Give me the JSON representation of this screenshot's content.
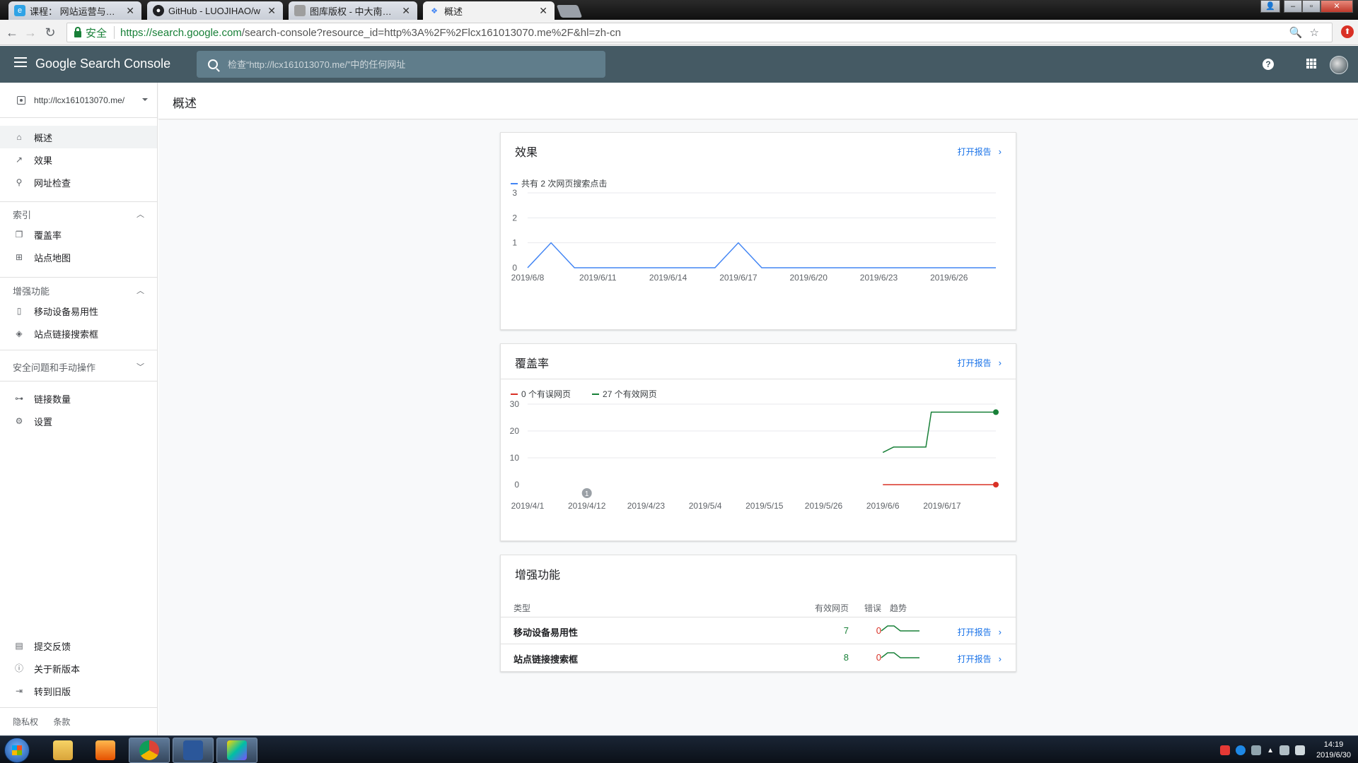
{
  "browser": {
    "tabs": [
      {
        "title": "课程： 网站运营与管理_",
        "favicon_color": "#2fa3e6"
      },
      {
        "title": "GitHub - LUOJIHAO/w",
        "favicon_color": "#202124"
      },
      {
        "title": "图库版权 - 中大南方大数",
        "favicon_color": "#9e9e9e"
      },
      {
        "title": "概述",
        "favicon_color": "#4285f4"
      }
    ],
    "secure_label": "安全",
    "url_main": "https://search.google.com",
    "url_rest": "/search-console?resource_id=http%3A%2F%2Flcx161013070.me%2F&hl=zh-cn"
  },
  "app": {
    "brand": "Google Search Console",
    "search_placeholder": "检查“http://lcx161013070.me/”中的任何网址"
  },
  "sidebar": {
    "property": "http://lcx161013070.me/",
    "top_items": [
      {
        "label": "概述",
        "icon": "home-icon"
      },
      {
        "label": "效果",
        "icon": "trending-up-icon"
      },
      {
        "label": "网址检查",
        "icon": "search-icon"
      }
    ],
    "section_index": "索引",
    "index_items": [
      {
        "label": "覆盖率",
        "icon": "copy-icon"
      },
      {
        "label": "站点地图",
        "icon": "sitemap-icon"
      }
    ],
    "section_enhance": "增强功能",
    "enhance_items": [
      {
        "label": "移动设备易用性",
        "icon": "phone-icon"
      },
      {
        "label": "站点链接搜索框",
        "icon": "layers-icon"
      }
    ],
    "section_security": "安全问题和手动操作",
    "other_items": [
      {
        "label": "链接数量",
        "icon": "links-icon"
      },
      {
        "label": "设置",
        "icon": "gear-icon"
      }
    ],
    "bottom_items": [
      {
        "label": "提交反馈",
        "icon": "feedback-icon"
      },
      {
        "label": "关于新版本",
        "icon": "info-icon"
      },
      {
        "label": "转到旧版",
        "icon": "exit-icon"
      }
    ],
    "footer_privacy": "隐私权",
    "footer_terms": "条款"
  },
  "page": {
    "title": "概述"
  },
  "performance": {
    "title": "效果",
    "open_report": "打开报告",
    "legend": "共有 2 次网页搜索点击",
    "color": "#4285f4"
  },
  "coverage": {
    "title": "覆盖率",
    "open_report": "打开报告",
    "legend_error": "0 个有误网页",
    "legend_valid": "27 个有效网页",
    "error_color": "#d93025",
    "valid_color": "#188038",
    "annotation": "1"
  },
  "enhancements": {
    "title": "增强功能",
    "headers": {
      "type": "类型",
      "valid": "有效网页",
      "errors": "错误",
      "trend": "趋势"
    },
    "rows": [
      {
        "name": "移动设备易用性",
        "valid": "7",
        "errors": "0",
        "open_report": "打开报告",
        "trend": [
          6,
          7,
          7,
          6,
          6,
          6,
          6
        ]
      },
      {
        "name": "站点链接搜索框",
        "valid": "8",
        "errors": "0",
        "open_report": "打开报告",
        "trend": [
          7,
          8,
          8,
          7,
          7,
          7,
          7
        ]
      }
    ]
  },
  "chart_data": [
    {
      "type": "line",
      "title": "效果",
      "series": [
        {
          "name": "共有 2 次网页搜索点击",
          "values": [
            0,
            1,
            0,
            0,
            0,
            0,
            0,
            0,
            0,
            1,
            0,
            0,
            0,
            0,
            0,
            0,
            0,
            0,
            0,
            0,
            0
          ]
        }
      ],
      "x": [
        "2019/6/8",
        "2019/6/9",
        "2019/6/10",
        "2019/6/11",
        "2019/6/12",
        "2019/6/13",
        "2019/6/14",
        "2019/6/15",
        "2019/6/16",
        "2019/6/17",
        "2019/6/18",
        "2019/6/19",
        "2019/6/20",
        "2019/6/21",
        "2019/6/22",
        "2019/6/23",
        "2019/6/24",
        "2019/6/25",
        "2019/6/26",
        "2019/6/27",
        "2019/6/28"
      ],
      "x_ticks": [
        "2019/6/8",
        "2019/6/11",
        "2019/6/14",
        "2019/6/17",
        "2019/6/20",
        "2019/6/23",
        "2019/6/26"
      ],
      "y_ticks": [
        0,
        1,
        2,
        3
      ],
      "ylim": [
        0,
        3
      ],
      "grid": true
    },
    {
      "type": "line",
      "title": "覆盖率",
      "x_ticks": [
        "2019/4/1",
        "2019/4/12",
        "2019/4/23",
        "2019/5/4",
        "2019/5/15",
        "2019/5/26",
        "2019/6/6",
        "2019/6/17"
      ],
      "xlim": [
        "2019/4/1",
        "2019/6/27"
      ],
      "y_ticks": [
        0,
        10,
        20,
        30
      ],
      "ylim": [
        0,
        30
      ],
      "grid": true,
      "series": [
        {
          "name": "27 个有效网页",
          "x": [
            "2019/6/6",
            "2019/6/8",
            "2019/6/14",
            "2019/6/15",
            "2019/6/27"
          ],
          "values": [
            12,
            14,
            14,
            27,
            27
          ]
        },
        {
          "name": "0 个有误网页",
          "x": [
            "2019/6/6",
            "2019/6/27"
          ],
          "values": [
            0,
            0
          ]
        }
      ],
      "annotation": {
        "x": "2019/4/12",
        "label": "1"
      }
    }
  ]
}
